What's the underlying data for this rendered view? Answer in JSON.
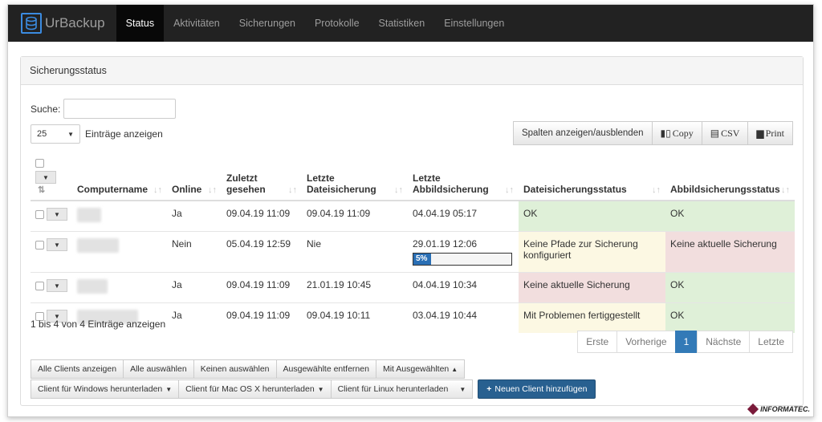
{
  "app": {
    "brand": "UrBackup"
  },
  "nav": [
    {
      "label": "Status",
      "active": true
    },
    {
      "label": "Aktivitäten"
    },
    {
      "label": "Sicherungen"
    },
    {
      "label": "Protokolle"
    },
    {
      "label": "Statistiken"
    },
    {
      "label": "Einstellungen"
    }
  ],
  "panel": {
    "title": "Sicherungsstatus"
  },
  "search": {
    "label": "Suche:",
    "value": ""
  },
  "length": {
    "value": "25",
    "label": "Einträge anzeigen"
  },
  "toolbar": {
    "columns": "Spalten anzeigen/ausblenden",
    "copy": "Copy",
    "csv": "CSV",
    "print": "Print"
  },
  "table": {
    "headers": {
      "computername": "Computername",
      "online": "Online",
      "last_seen": "Zuletzt gesehen",
      "last_file": "Letzte Dateisicherung",
      "last_image": "Letzte Abbildsicherung",
      "file_status": "Dateisicherungsstatus",
      "image_status": "Abbildsicherungsstatus"
    },
    "rows": [
      {
        "online": "Ja",
        "last_seen": "09.04.19 11:09",
        "last_file": "09.04.19 11:09",
        "last_image": "04.04.19 05:17",
        "file_status": "OK",
        "image_status": "OK"
      },
      {
        "online": "Nein",
        "last_seen": "05.04.19 12:59",
        "last_file": "Nie",
        "last_image": "29.01.19 12:06",
        "progress": "5%",
        "file_status": "Keine Pfade zur Sicherung konfiguriert",
        "image_status": "Keine aktuelle Sicherung"
      },
      {
        "online": "Ja",
        "last_seen": "09.04.19 11:09",
        "last_file": "21.01.19 10:45",
        "last_image": "04.04.19 10:34",
        "file_status": "Keine aktuelle Sicherung",
        "image_status": "OK"
      },
      {
        "online": "Ja",
        "last_seen": "09.04.19 11:09",
        "last_file": "09.04.19 10:11",
        "last_image": "03.04.19 10:44",
        "file_status": "Mit Problemen fertiggestellt",
        "image_status": "OK"
      }
    ]
  },
  "info": "1 bis 4 von 4 Einträge anzeigen",
  "pager": {
    "first": "Erste",
    "prev": "Vorherige",
    "current": "1",
    "next": "Nächste",
    "last": "Letzte"
  },
  "actions": {
    "show_all": "Alle Clients anzeigen",
    "select_all": "Alle auswählen",
    "select_none": "Keinen auswählen",
    "remove_selected": "Ausgewählte entfernen",
    "with_selected": "Mit Ausgewählten",
    "dl_windows": "Client für Windows herunterladen",
    "dl_mac": "Client für Mac OS X herunterladen",
    "dl_linux": "Client für Linux herunterladen",
    "add_client": "Neuen Client hinzufügen"
  },
  "watermark": "INFORMATEC."
}
